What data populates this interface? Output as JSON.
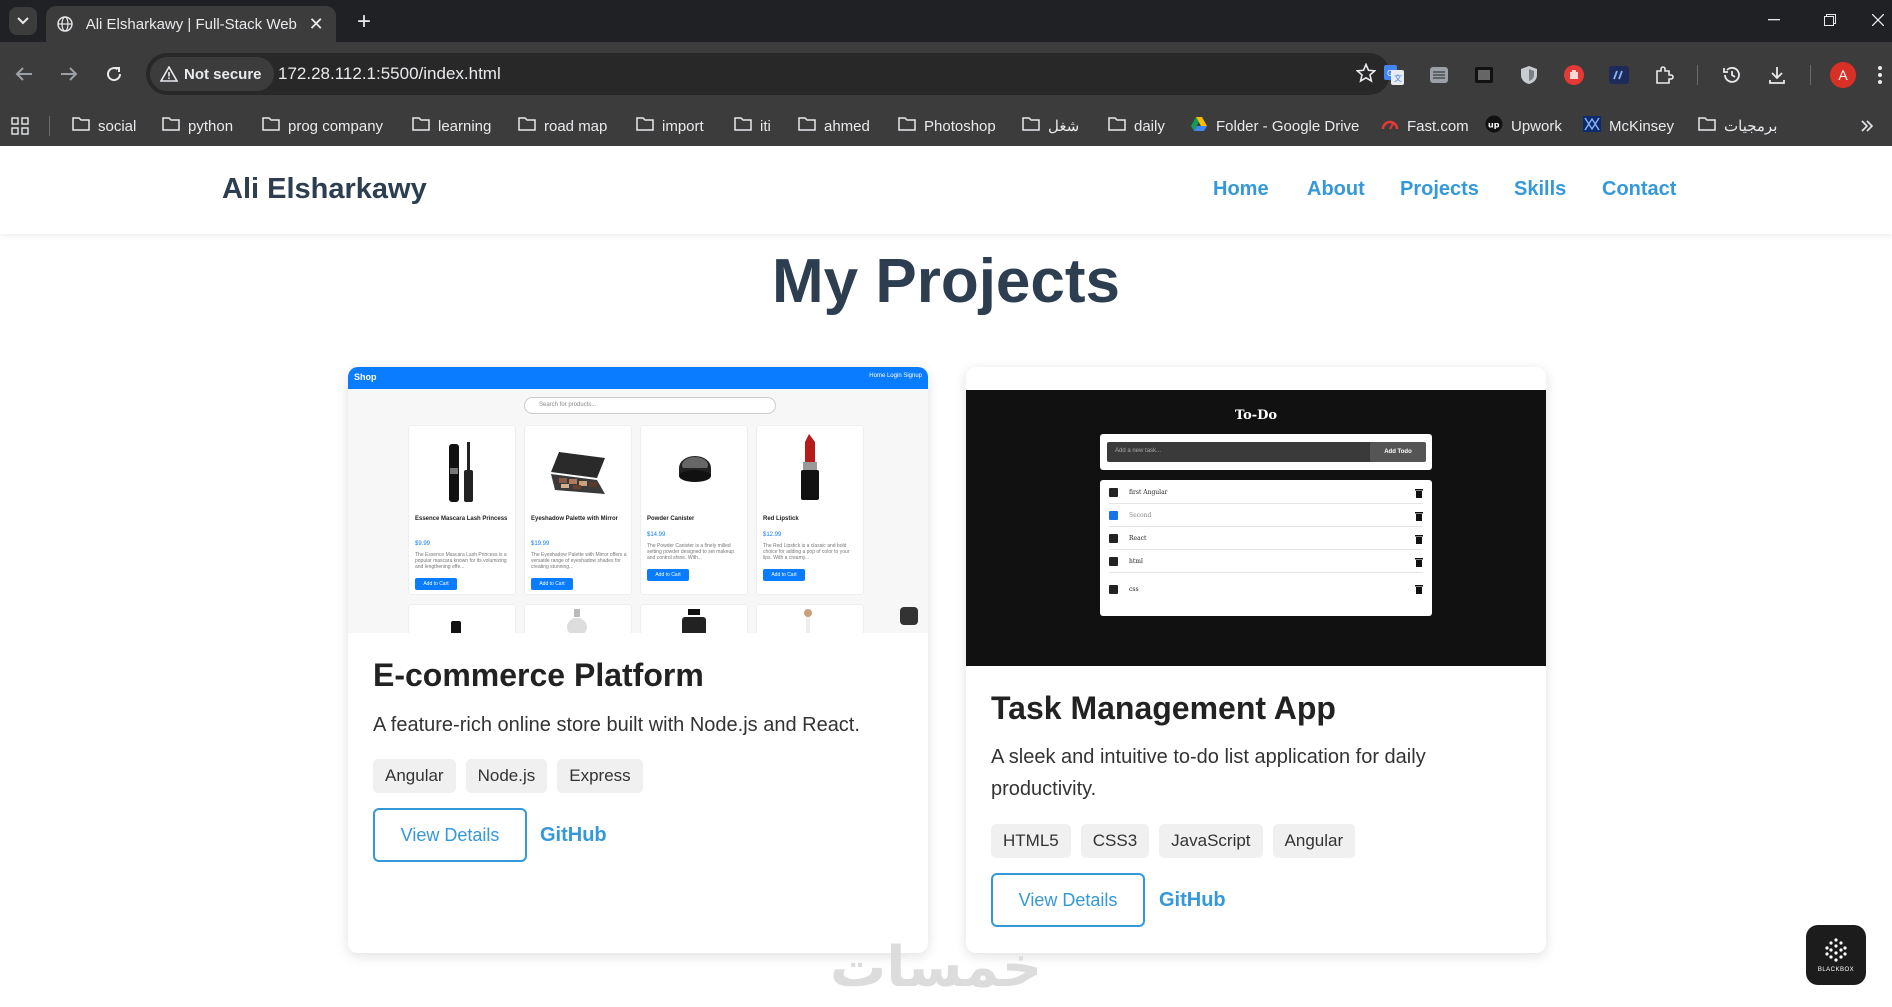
{
  "browser": {
    "tab": {
      "title": "Ali Elsharkawy | Full-Stack Web"
    },
    "security": {
      "label": "Not secure"
    },
    "url": "172.28.112.1:5500/index.html",
    "profile_initial": "A",
    "bookmarks": [
      {
        "label": "social",
        "icon": "folder-icon"
      },
      {
        "label": "python",
        "icon": "folder-icon"
      },
      {
        "label": "prog company",
        "icon": "folder-icon"
      },
      {
        "label": "learning",
        "icon": "folder-icon"
      },
      {
        "label": "road map",
        "icon": "folder-icon"
      },
      {
        "label": "import",
        "icon": "folder-icon"
      },
      {
        "label": "iti",
        "icon": "folder-icon"
      },
      {
        "label": "ahmed",
        "icon": "folder-icon"
      },
      {
        "label": "Photoshop",
        "icon": "folder-icon"
      },
      {
        "label": "شغل",
        "icon": "folder-icon"
      },
      {
        "label": "daily",
        "icon": "folder-icon"
      },
      {
        "label": "Folder - Google Drive",
        "icon": "google-drive-icon"
      },
      {
        "label": "Fast.com",
        "icon": "fast-icon"
      },
      {
        "label": "Upwork",
        "icon": "upwork-icon"
      },
      {
        "label": "McKinsey",
        "icon": "mckinsey-icon"
      },
      {
        "label": "برمجيات",
        "icon": "folder-icon"
      }
    ]
  },
  "site": {
    "logo": "Ali Elsharkawy",
    "nav": [
      "Home",
      "About",
      "Projects",
      "Skills",
      "Contact"
    ],
    "section_title": "My Projects",
    "projects": [
      {
        "title": "E-commerce Platform",
        "description": "A feature-rich online store built with Node.js and React.",
        "tags": [
          "Angular",
          "Node.js",
          "Express"
        ],
        "details_label": "View Details",
        "github_label": "GitHub",
        "preview": {
          "brand": "Shop",
          "links": "Home   Login   Signup",
          "search_placeholder": "Search for products...",
          "products": [
            {
              "name": "Essence Mascara Lash Princess",
              "price": "$9.99",
              "text": "The Essence Mascara Lash Princess is a popular mascara known for its volumizing and lengthening effe...",
              "button": "Add to Cart"
            },
            {
              "name": "Eyeshadow Palette with Mirror",
              "price": "$19.99",
              "text": "The Eyeshadow Palette with Mirror offers a versatile range of eyeshadow shades for creating stunning...",
              "button": "Add to Cart"
            },
            {
              "name": "Powder Canister",
              "price": "$14.99",
              "text": "The Powder Canister is a finely milled setting powder designed to set makeup and control shine. With...",
              "button": "Add to Cart"
            },
            {
              "name": "Red Lipstick",
              "price": "$12.99",
              "text": "The Red Lipstick is a classic and bold choice for adding a pop of color to your lips. With a creamy...",
              "button": "Add to Cart"
            }
          ]
        }
      },
      {
        "title": "Task Management App",
        "description": "A sleek and intuitive to-do list application for daily productivity.",
        "tags": [
          "HTML5",
          "CSS3",
          "JavaScript",
          "Angular"
        ],
        "details_label": "View Details",
        "github_label": "GitHub",
        "preview": {
          "title": "To-Do",
          "input_placeholder": "Add a new task...",
          "add_button": "Add Todo",
          "items": [
            {
              "text": "first Angular",
              "done": false
            },
            {
              "text": "Second",
              "done": true
            },
            {
              "text": "React",
              "done": false
            },
            {
              "text": "html",
              "done": false
            },
            {
              "text": "css",
              "done": false
            }
          ]
        }
      }
    ]
  },
  "overlay": {
    "watermark": "خمسات",
    "blackbox_label": "BLACKBOX"
  },
  "colors": {
    "accent": "#3498db",
    "heading": "#2c3e50",
    "shop_blue": "#0a7cff",
    "browser_bg": "#3c3c3c"
  }
}
